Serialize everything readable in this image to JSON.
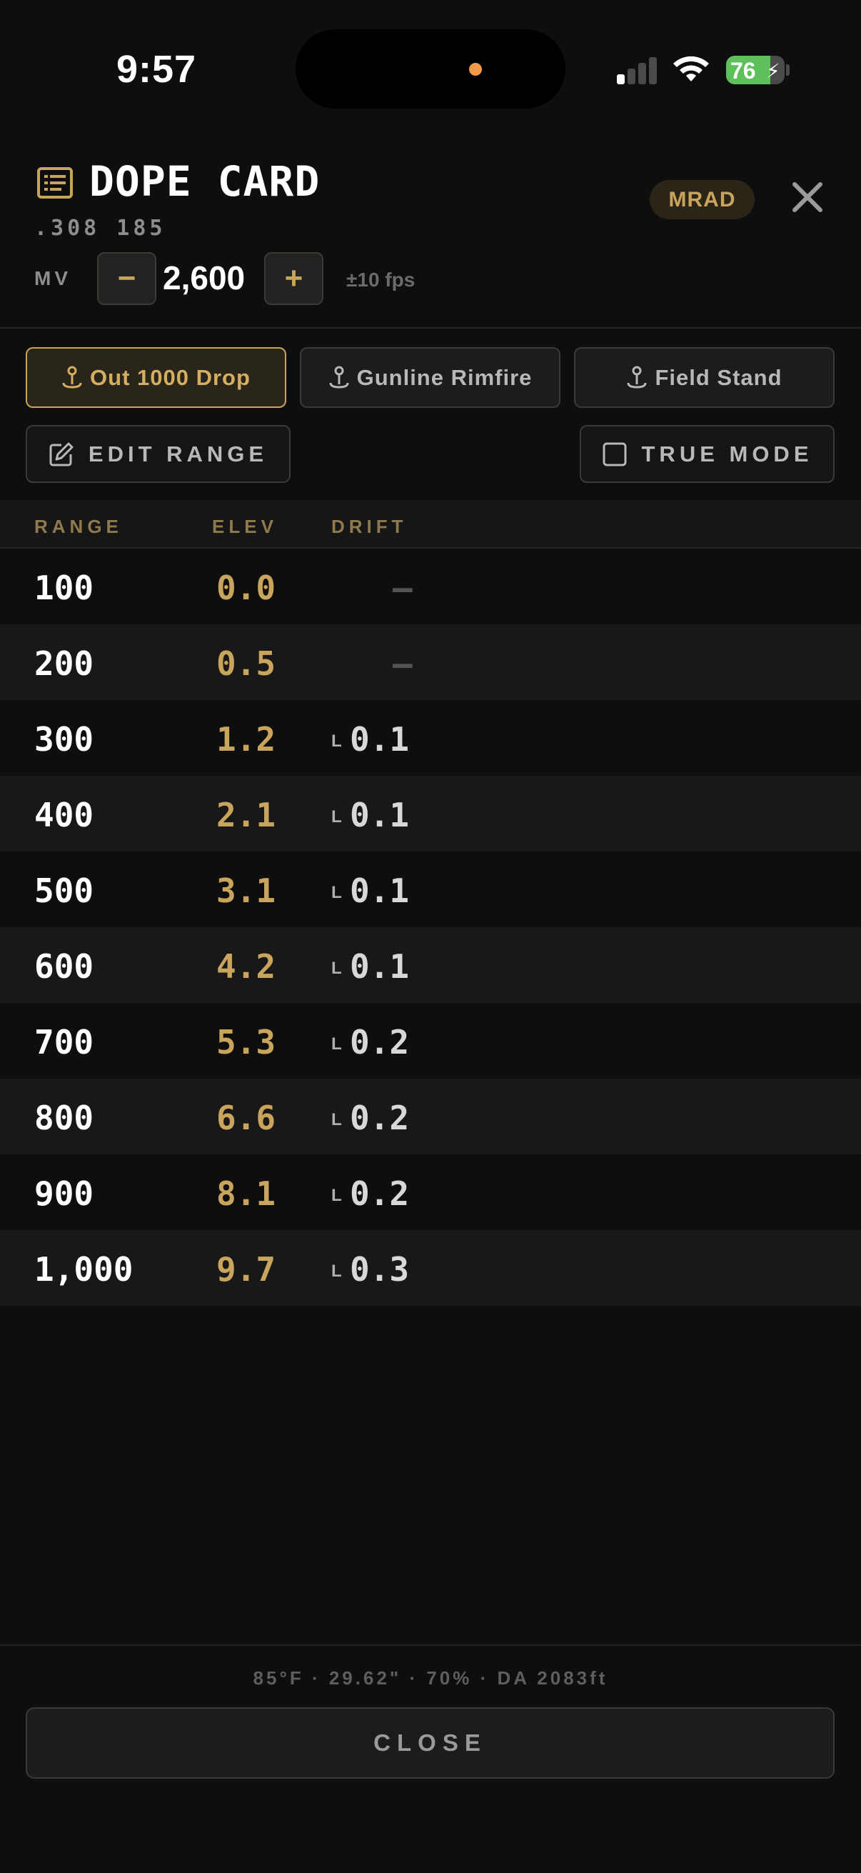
{
  "status_bar": {
    "time": "9:57",
    "battery_percent": "76",
    "battery_level": 0.76,
    "signal_bars_active": 1,
    "signal_bars_total": 4
  },
  "header": {
    "title": "DOPE CARD",
    "subtitle": ".308 185",
    "unit_badge": "MRAD",
    "icon": "document-list-icon",
    "close_icon": "close-icon"
  },
  "muzzle_velocity": {
    "label": "MV",
    "decrement_label": "−",
    "value": "2,600",
    "increment_label": "+",
    "step_hint": "±10 fps"
  },
  "profiles": [
    {
      "label": "Out 1000 Drop",
      "active": true,
      "icon": "pin-icon"
    },
    {
      "label": "Gunline Rimfire",
      "active": false,
      "icon": "pin-icon"
    },
    {
      "label": "Field Stand",
      "active": false,
      "icon": "pin-icon"
    }
  ],
  "tools": {
    "edit_range_label": "EDIT RANGE",
    "true_mode_label": "TRUE MODE",
    "true_mode_checked": false
  },
  "table": {
    "headers": {
      "range": "RANGE",
      "elev": "ELEV",
      "drift": "DRIFT"
    },
    "rows": [
      {
        "range": "100",
        "elev": "0.0",
        "dir": "",
        "drift": "—"
      },
      {
        "range": "200",
        "elev": "0.5",
        "dir": "",
        "drift": "—"
      },
      {
        "range": "300",
        "elev": "1.2",
        "dir": "L",
        "drift": "0.1"
      },
      {
        "range": "400",
        "elev": "2.1",
        "dir": "L",
        "drift": "0.1"
      },
      {
        "range": "500",
        "elev": "3.1",
        "dir": "L",
        "drift": "0.1"
      },
      {
        "range": "600",
        "elev": "4.2",
        "dir": "L",
        "drift": "0.1"
      },
      {
        "range": "700",
        "elev": "5.3",
        "dir": "L",
        "drift": "0.2"
      },
      {
        "range": "800",
        "elev": "6.6",
        "dir": "L",
        "drift": "0.2"
      },
      {
        "range": "900",
        "elev": "8.1",
        "dir": "L",
        "drift": "0.2"
      },
      {
        "range": "1,000",
        "elev": "9.7",
        "dir": "L",
        "drift": "0.3"
      }
    ]
  },
  "footer": {
    "conditions": "85°F · 29.62\" · 70% · DA 2083ft",
    "close_label": "CLOSE"
  },
  "colors": {
    "accent": "#c9a45c",
    "background": "#0e0e0e",
    "battery": "#5dc05a"
  }
}
